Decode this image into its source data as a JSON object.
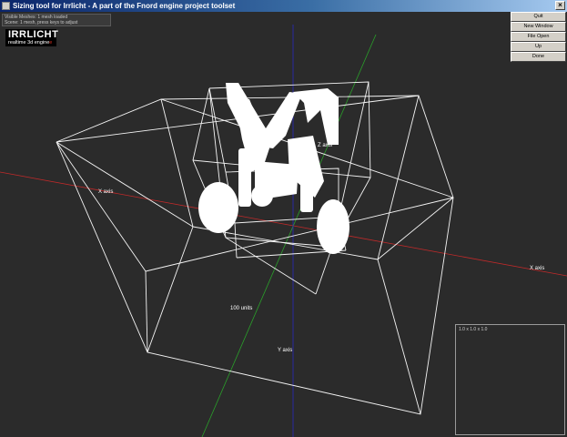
{
  "window": {
    "title": "Sizing tool for Irrlicht - A part of the Fnord engine project toolset",
    "close_glyph": "×"
  },
  "info": {
    "line1": "Visible Meshes: 1 mesh loaded",
    "line2": "Scene: 1 mesh, press keys to adjust"
  },
  "logo": {
    "main": "IRRLICHT",
    "sub": "realtime 3d engine",
    "sub_accent": "e"
  },
  "buttons": [
    {
      "label": "Quit"
    },
    {
      "label": "New Window"
    },
    {
      "label": "File Open"
    },
    {
      "label": "Up"
    },
    {
      "label": "Done"
    }
  ],
  "axes": {
    "x_left": "X axis",
    "x_right": "X axis",
    "z": "Z axis",
    "y": "Y axis",
    "units": "100 units"
  },
  "side_panel": {
    "label": "1.0 x 1.0 x 1.0"
  },
  "colors": {
    "background": "#2b2b2b",
    "wireframe": "#f4f4f4",
    "axis_x": "#c02a2a",
    "axis_y": "#2aa02a",
    "axis_z": "#2a2ac0"
  }
}
